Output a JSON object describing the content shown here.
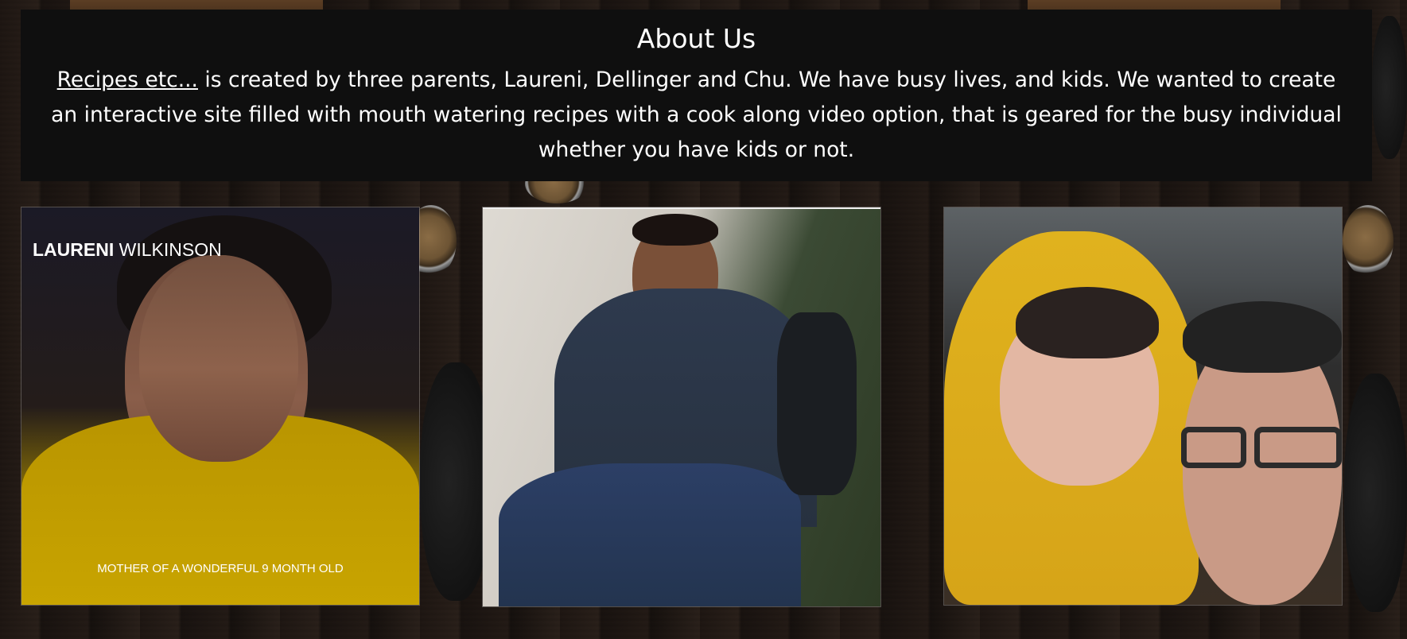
{
  "about": {
    "title": "About Us",
    "link_text": "Recipes etc...",
    "description": " is created by three parents, Laureni, Dellinger and Chu. We have busy lives, and kids. We wanted to create an interactive site filled with mouth watering recipes with a cook along video option, that is geared for the busy individual whether you have kids or not."
  },
  "team": [
    {
      "first_name": "LAURENI",
      "last_name": " WILKINSON",
      "caption": "MOTHER OF A WONDERFUL 9 MONTH OLD"
    },
    {},
    {}
  ],
  "colors": {
    "header_bg": "#0f0f0f",
    "text": "#ffffff"
  }
}
